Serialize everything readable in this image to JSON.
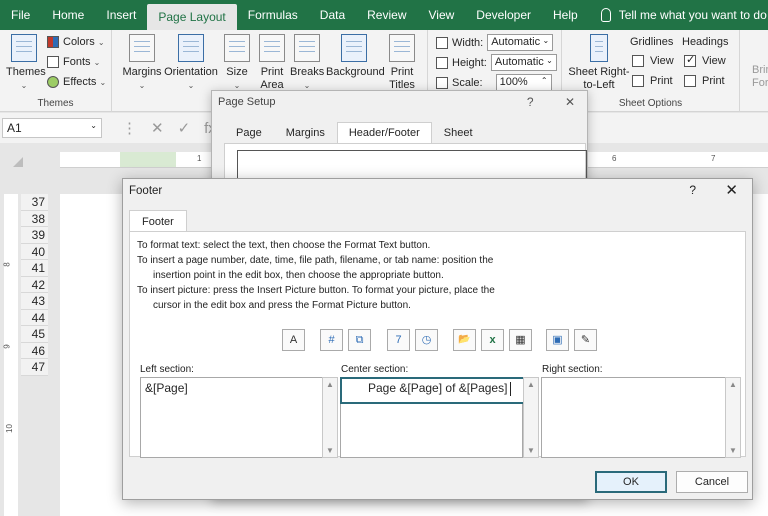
{
  "menu": {
    "tabs": [
      "File",
      "Home",
      "Insert",
      "Page Layout",
      "Formulas",
      "Data",
      "Review",
      "View",
      "Developer",
      "Help"
    ],
    "active_tab": "Page Layout",
    "tell_me": "Tell me what you want to do"
  },
  "ribbon": {
    "themes_group": {
      "label": "Themes",
      "themes": "Themes",
      "colors": "Colors",
      "fonts": "Fonts",
      "effects": "Effects"
    },
    "page_setup_group": {
      "margins": "Margins",
      "orientation": "Orientation",
      "size": "Size",
      "print_area_1": "Print",
      "print_area_2": "Area",
      "breaks": "Breaks",
      "background": "Background",
      "print_titles_1": "Print",
      "print_titles_2": "Titles"
    },
    "scale_group": {
      "width_label": "Width:",
      "width_value": "Automatic",
      "height_label": "Height:",
      "height_value": "Automatic",
      "scale_label": "Scale:",
      "scale_value": "100%"
    },
    "sheet_options_group": {
      "label": "Sheet Options",
      "rtl_1": "Sheet Right-",
      "rtl_2": "to-Left",
      "gridlines": "Gridlines",
      "headings": "Headings",
      "view": "View",
      "print": "Print",
      "gridlines_view_checked": false,
      "headings_view_checked": true
    },
    "arrange_group": {
      "bring_forward_1": "Bring",
      "bring_forward_2": "Forwa"
    }
  },
  "formula_bar": {
    "name_box": "A1",
    "fx": "fx"
  },
  "sheet": {
    "row_numbers": [
      "37",
      "38",
      "39",
      "40",
      "41",
      "42",
      "43",
      "44",
      "45",
      "46",
      "47"
    ],
    "ruler_ticks": [
      "1",
      "6",
      "7"
    ],
    "vruler_ticks": [
      "8",
      "9",
      "10"
    ]
  },
  "page_setup_dialog": {
    "title": "Page Setup",
    "help": "?",
    "close": "✕",
    "tabs": [
      "Page",
      "Margins",
      "Header/Footer",
      "Sheet"
    ],
    "active_tab": "Header/Footer"
  },
  "footer_dialog": {
    "title": "Footer",
    "help": "?",
    "close": "✕",
    "tab": "Footer",
    "instructions": [
      "To format text:  select the text, then choose the Format Text button.",
      "To insert a page number, date, time, file path, filename, or tab name:  position the",
      "insertion point in the edit box, then choose the appropriate button.",
      "To insert picture: press the Insert Picture button.  To format your picture, place the",
      "cursor in the edit box and press the Format Picture button."
    ],
    "toolbar_buttons": [
      {
        "icon": "format-text-icon",
        "glyph": "A"
      },
      {
        "icon": "page-number-icon",
        "glyph": "#"
      },
      {
        "icon": "number-of-pages-icon",
        "glyph": "⧉"
      },
      {
        "icon": "date-icon",
        "glyph": "7"
      },
      {
        "icon": "time-icon",
        "glyph": "◷"
      },
      {
        "icon": "file-path-icon",
        "glyph": "📂"
      },
      {
        "icon": "file-name-icon",
        "glyph": "x"
      },
      {
        "icon": "sheet-name-icon",
        "glyph": "▦"
      },
      {
        "icon": "insert-picture-icon",
        "glyph": "▣"
      },
      {
        "icon": "format-picture-icon",
        "glyph": "✎"
      }
    ],
    "left_label": "Left section:",
    "center_label": "Center section:",
    "right_label": "Right section:",
    "left_value": "&[Page]",
    "center_value": "Page &[Page] of &[Pages]",
    "right_value": "",
    "ok": "OK",
    "cancel": "Cancel"
  }
}
